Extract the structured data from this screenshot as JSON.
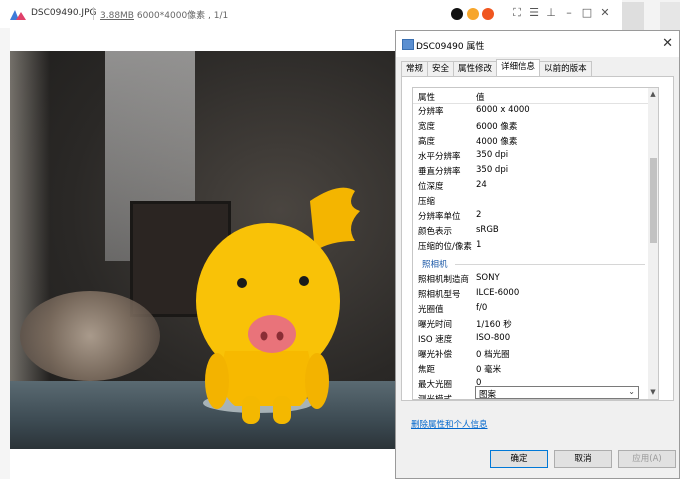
{
  "viewer": {
    "filename": "DSC09490.JPG",
    "filesize": "3.88MB",
    "dimensions": "6000*4000像素",
    "page_index": ", 1/1",
    "controls": [
      "fullscreen-icon",
      "menu-icon",
      "pin-icon",
      "minimize-icon",
      "maximize-icon",
      "close-icon"
    ]
  },
  "dialog": {
    "title": "DSC09490 属性",
    "tabs": [
      "常规",
      "安全",
      "属性修改",
      "详细信息",
      "以前的版本"
    ],
    "active_tab": "详细信息",
    "header": {
      "prop": "属性",
      "value": "值"
    },
    "rows_image": [
      {
        "k": "分辨率",
        "v": "6000 x 4000"
      },
      {
        "k": "宽度",
        "v": "6000 像素"
      },
      {
        "k": "高度",
        "v": "4000 像素"
      },
      {
        "k": "水平分辨率",
        "v": "350 dpi"
      },
      {
        "k": "垂直分辨率",
        "v": "350 dpi"
      },
      {
        "k": "位深度",
        "v": "24"
      },
      {
        "k": "压缩",
        "v": ""
      },
      {
        "k": "分辨率单位",
        "v": "2"
      },
      {
        "k": "颜色表示",
        "v": "sRGB"
      },
      {
        "k": "压缩的位/像素",
        "v": "1"
      }
    ],
    "group_camera": "照相机",
    "rows_camera": [
      {
        "k": "照相机制造商",
        "v": "SONY"
      },
      {
        "k": "照相机型号",
        "v": "ILCE-6000"
      },
      {
        "k": "光圈值",
        "v": "f/0"
      },
      {
        "k": "曝光时间",
        "v": "1/160 秒"
      },
      {
        "k": "ISO 速度",
        "v": "ISO-800"
      },
      {
        "k": "曝光补偿",
        "v": "0 档光圈"
      },
      {
        "k": "焦距",
        "v": "0 毫米"
      },
      {
        "k": "最大光圈",
        "v": "0"
      },
      {
        "k": "测光模式",
        "v": ""
      }
    ],
    "metering_combo_value": "图案",
    "remove_link": "删除属性和个人信息",
    "buttons": {
      "ok": "确定",
      "cancel": "取消",
      "apply": "应用(A)"
    }
  }
}
